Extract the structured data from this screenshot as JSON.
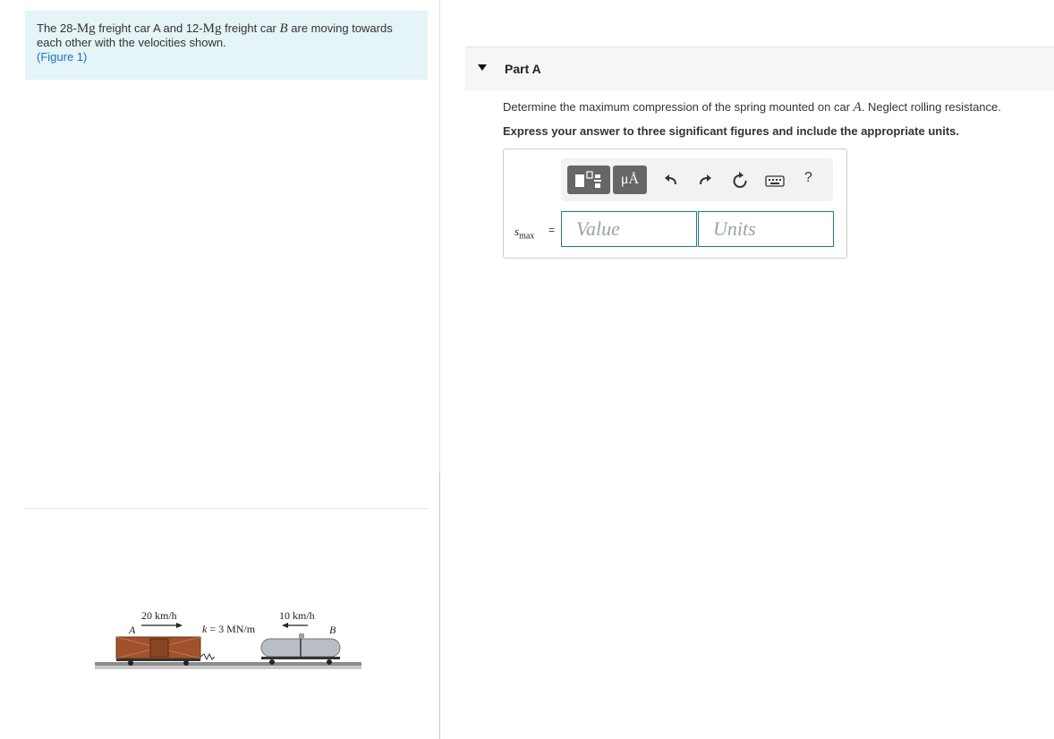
{
  "problem": {
    "t1": "The 28-",
    "mass_a_unit": "Mg",
    "t2": " freight car A and 12-",
    "mass_b_unit": "Mg",
    "t3": " freight car ",
    "car_b": "B",
    "t4": " are moving towards each other with the velocities shown.",
    "figure_link": "(Figure 1)"
  },
  "figure": {
    "velocity_a": "20 km/h",
    "velocity_b": "10 km/h",
    "label_a": "A",
    "label_b": "B",
    "spring_k_sym": "k",
    "spring_k_val": " = 3 MN/m"
  },
  "part": {
    "label": "Part A",
    "question_pre": "Determine the maximum compression of the spring mounted on car ",
    "question_var": "A",
    "question_post": ". Neglect rolling resistance.",
    "instruction": "Express your answer to three significant figures and include the appropriate units."
  },
  "answer": {
    "var_main": "s",
    "var_sub": "max",
    "equals": "=",
    "value_placeholder": "Value",
    "units_placeholder": "Units"
  },
  "toolbar": {
    "units_button": "μÅ",
    "help": "?"
  },
  "colors": {
    "problem_bg": "#e5f4f6",
    "link": "#1b75bc",
    "input_border": "#1d7a8c",
    "toolbar_button": "#666666"
  }
}
